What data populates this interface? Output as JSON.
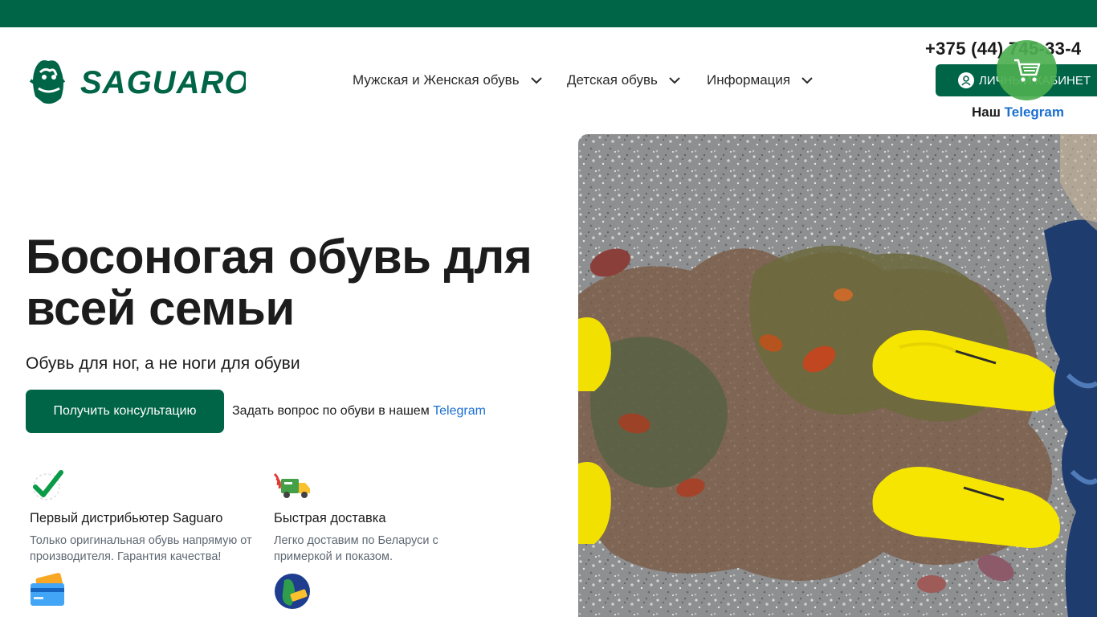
{
  "brand": {
    "name": "SAGUARO"
  },
  "nav": {
    "items": [
      {
        "label": "Мужская и Женская обувь"
      },
      {
        "label": "Детская обувь"
      },
      {
        "label": "Информация"
      }
    ]
  },
  "header": {
    "phone": "+375 (44) 745-33-4",
    "account_label": "ЛИЧНЫЙ КАБИНЕТ",
    "telegram_prefix": "Наш",
    "telegram_link": "Telegram"
  },
  "hero": {
    "title": "Босоногая обувь для всей семьи",
    "subtitle": "Обувь для ног, а не ноги для обуви",
    "cta_label": "Получить консультацию",
    "ask_text": "Задать вопрос по обуви в нашем",
    "ask_link": "Telegram"
  },
  "features": [
    {
      "icon": "checkmark-icon",
      "title": "Первый дистрибьютер Saguaro",
      "desc": "Только оригинальная обувь напрямую от производителя. Гарантия качества!"
    },
    {
      "icon": "delivery-truck-icon",
      "title": "Быстрая доставка",
      "desc": "Легко доставим по Беларуси с примеркой и показом."
    },
    {
      "icon": "credit-card-icon",
      "title": "",
      "desc": ""
    },
    {
      "icon": "foot-measure-icon",
      "title": "",
      "desc": ""
    }
  ],
  "colors": {
    "brand_green": "#006446",
    "link_blue": "#1a6fd1",
    "cart_green": "#4caf50"
  }
}
